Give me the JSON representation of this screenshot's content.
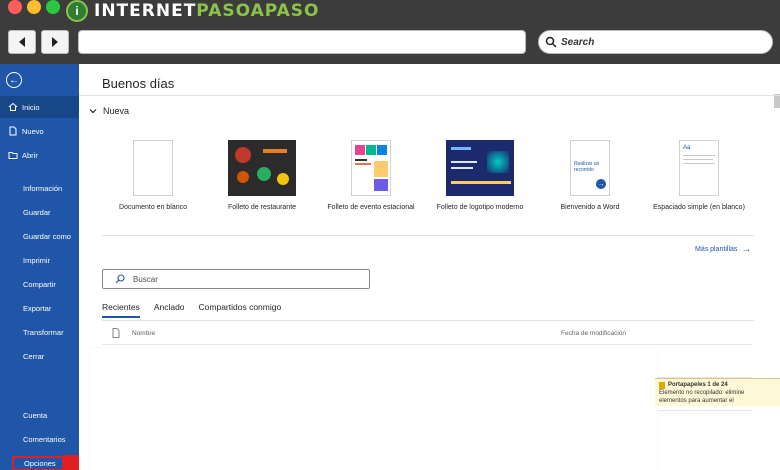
{
  "brand": {
    "name_part1": "INTERNET",
    "name_part2": "PASOAPASO",
    "logo_text": "i"
  },
  "browser": {
    "search_placeholder": "Search"
  },
  "sidebar": {
    "items": [
      {
        "label": "Inicio",
        "icon": "home-icon"
      },
      {
        "label": "Nuevo",
        "icon": "new-doc-icon"
      },
      {
        "label": "Abrir",
        "icon": "folder-icon"
      },
      {
        "label": "Información"
      },
      {
        "label": "Guardar"
      },
      {
        "label": "Guardar como"
      },
      {
        "label": "Imprimir"
      },
      {
        "label": "Compartir"
      },
      {
        "label": "Exportar"
      },
      {
        "label": "Transformar"
      },
      {
        "label": "Cerrar"
      },
      {
        "label": "Cuenta"
      },
      {
        "label": "Comentarios"
      },
      {
        "label": "Opciones"
      }
    ]
  },
  "main": {
    "greeting": "Buenos días",
    "new_section": "Nueva",
    "templates": [
      {
        "label": "Documento en blanco"
      },
      {
        "label": "Folleto de restaurante"
      },
      {
        "label": "Folleto de evento estacional"
      },
      {
        "label": "Folleto de logotipo moderno"
      },
      {
        "label": "Bienvenido a Word",
        "thumb_text": "Realizar un recorrido"
      },
      {
        "label": "Espaciado simple (en blanco)",
        "thumb_text": "Aa"
      }
    ],
    "more_templates": "Más plantillas",
    "search_placeholder": "Buscar",
    "tabs": [
      "Recientes",
      "Anclado",
      "Compartidos conmigo"
    ],
    "columns": {
      "name": "Nombre",
      "modified": "Fecha de modificación"
    }
  },
  "clipboard": {
    "title": "Portapapeles 1 de 24",
    "line1": "Elemento no recopilado: elimine",
    "line2": "elementos para aumentar el"
  },
  "colors": {
    "sidebar": "#1f56a8",
    "accent": "#1f56a8",
    "highlight": "#e02020"
  }
}
